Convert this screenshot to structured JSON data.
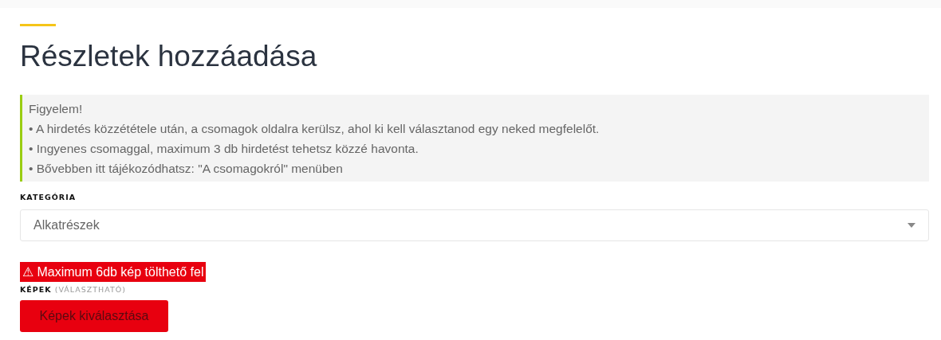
{
  "title": "Részletek hozzáadása",
  "notice": {
    "lines": [
      "Figyelem!",
      "• A hirdetés közzététele után, a csomagok oldalra kerülsz, ahol ki kell választanod egy neked megfelelőt.",
      "• Ingyenes csomaggal, maximum 3 db hirdetést tehetsz közzé havonta.",
      "• Bővebben itt tájékozódhatsz: \"A csomagokról\" menüben"
    ]
  },
  "category": {
    "label": "KATEGÓRIA",
    "value": "Alkatrészek"
  },
  "warning": "⚠ Maximum 6db kép tölthető fel",
  "images": {
    "label": "KÉPEK",
    "hint": "(VÁLASZTHATÓ)",
    "button": "Képek kiválasztása"
  }
}
